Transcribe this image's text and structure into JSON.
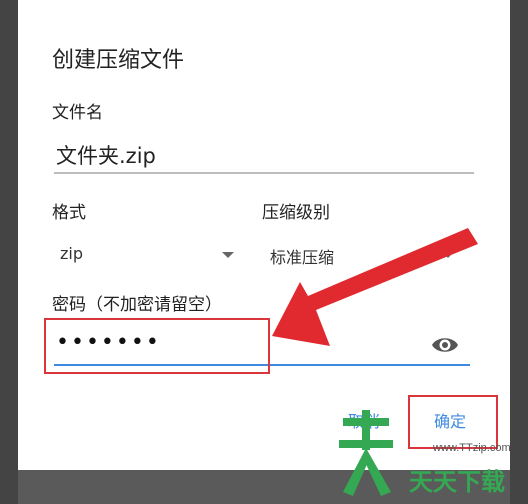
{
  "dialog": {
    "title": "创建压缩文件",
    "filename_label": "文件名",
    "filename_value": "文件夹.zip",
    "format_label": "格式",
    "level_label": "压缩级别",
    "format_value": "zip",
    "level_value": "标准压缩",
    "password_label": "密码（不加密请留空）",
    "password_mask": "•••••••",
    "cancel_label": "取消",
    "ok_label": "确定"
  },
  "icons": {
    "format_dropdown": "chevron-down-icon",
    "level_dropdown": "chevron-down-icon",
    "password_visibility": "eye-icon",
    "annotation_arrow": "red-arrow-icon"
  },
  "watermark": {
    "url": "www.TTzip.com",
    "brand": "天天下载"
  },
  "colors": {
    "accent": "#3f8ae0",
    "annotation_red": "#d9353b",
    "watermark_green": "#34a853"
  }
}
